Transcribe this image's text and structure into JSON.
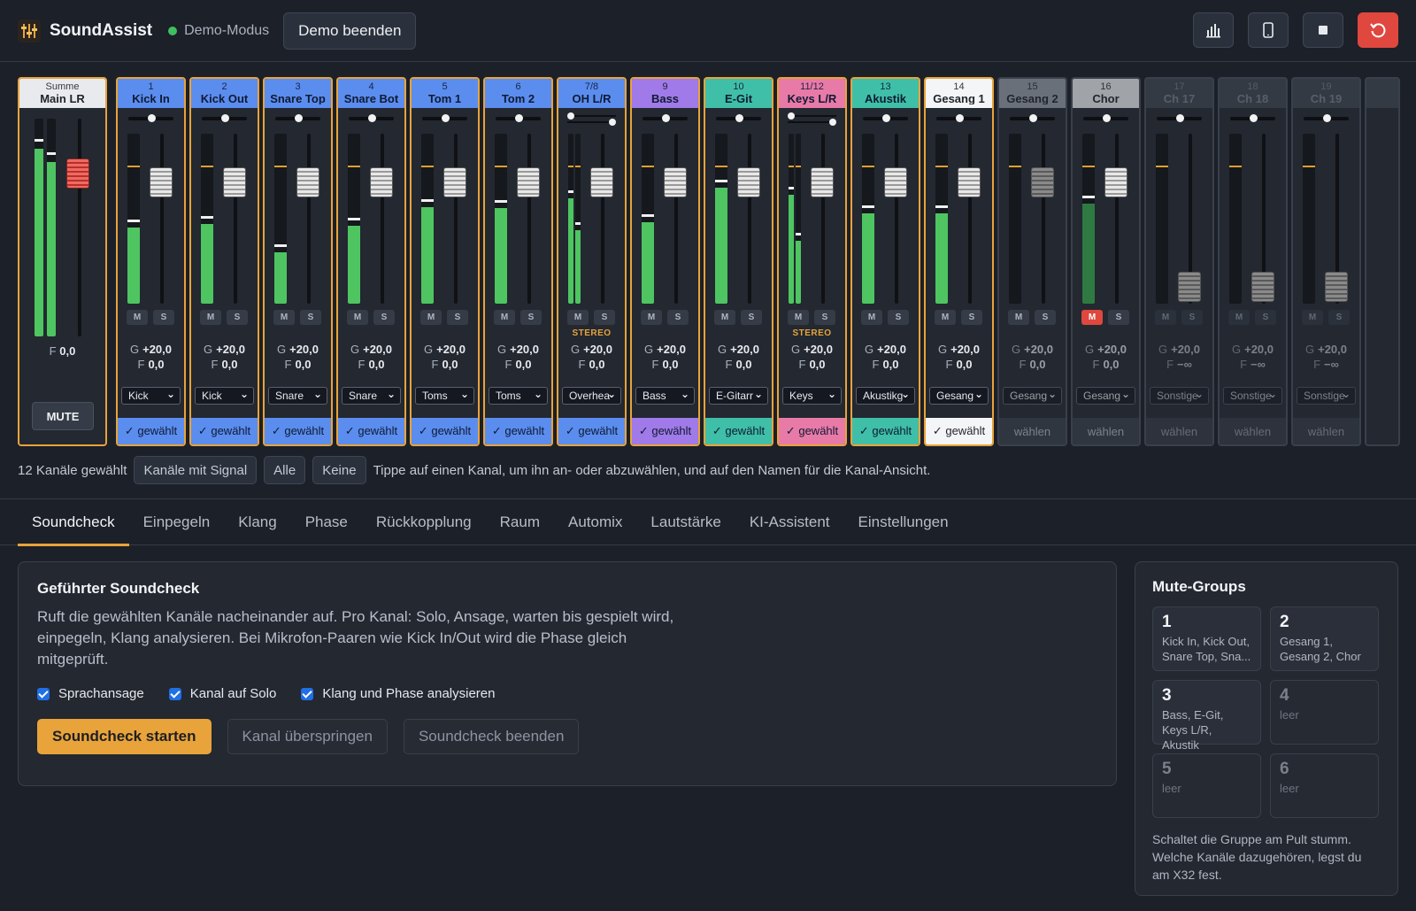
{
  "app": {
    "title": "SoundAssist",
    "mode_label": "Demo-Modus",
    "exit_demo": "Demo beenden"
  },
  "colors": {
    "accent": "#e8a33a",
    "meter": "#4ec561",
    "danger": "#e0473e",
    "blue": "#5b8def",
    "purple": "#a07ae8",
    "teal": "#3fbfa8",
    "pink": "#e87aa8"
  },
  "toolbar_icons": [
    "bar-chart-icon",
    "tablet-icon",
    "stop-icon",
    "reset-icon"
  ],
  "summe": {
    "label": "Summe",
    "name": "Main LR",
    "fader_label": "F",
    "fader_value": "0,0",
    "mute": "MUTE",
    "meter_levels": [
      0.86,
      0.8
    ],
    "fader_level": 0.75
  },
  "channels": [
    {
      "num": "1",
      "name": "Kick In",
      "gain": "+20,0",
      "fader": "0,0",
      "select": "Kick",
      "state": "✓ gewählt",
      "color": "#5b8def",
      "level": 0.45,
      "selected": true
    },
    {
      "num": "2",
      "name": "Kick Out",
      "gain": "+20,0",
      "fader": "0,0",
      "select": "Kick",
      "state": "✓ gewählt",
      "color": "#5b8def",
      "level": 0.47,
      "selected": true
    },
    {
      "num": "3",
      "name": "Snare Top",
      "gain": "+20,0",
      "fader": "0,0",
      "select": "Snare",
      "state": "✓ gewählt",
      "color": "#5b8def",
      "level": 0.3,
      "selected": true
    },
    {
      "num": "4",
      "name": "Snare Bot",
      "gain": "+20,0",
      "fader": "0,0",
      "select": "Snare",
      "state": "✓ gewählt",
      "color": "#5b8def",
      "level": 0.46,
      "selected": true
    },
    {
      "num": "5",
      "name": "Tom 1",
      "gain": "+20,0",
      "fader": "0,0",
      "select": "Toms",
      "state": "✓ gewählt",
      "color": "#5b8def",
      "level": 0.57,
      "selected": true
    },
    {
      "num": "6",
      "name": "Tom 2",
      "gain": "+20,0",
      "fader": "0,0",
      "select": "Toms",
      "state": "✓ gewählt",
      "color": "#5b8def",
      "level": 0.56,
      "selected": true
    },
    {
      "num": "7/8",
      "name": "OH L/R",
      "gain": "+20,0",
      "fader": "0,0",
      "select": "Overhea",
      "state": "✓ gewählt",
      "color": "#5b8def",
      "level": 0.62,
      "level_r": 0.43,
      "stereo": "STEREO",
      "selected": true
    },
    {
      "num": "9",
      "name": "Bass",
      "gain": "+20,0",
      "fader": "0,0",
      "select": "Bass",
      "state": "✓ gewählt",
      "color": "#a07ae8",
      "level": 0.48,
      "selected": true
    },
    {
      "num": "10",
      "name": "E-Git",
      "gain": "+20,0",
      "fader": "0,0",
      "select": "E-Gitarr",
      "state": "✓ gewählt",
      "color": "#3fbfa8",
      "level": 0.68,
      "selected": true
    },
    {
      "num": "11/12",
      "name": "Keys L/R",
      "gain": "+20,0",
      "fader": "0,0",
      "select": "Keys",
      "state": "✓ gewählt",
      "color": "#e87aa8",
      "level": 0.64,
      "level_r": 0.37,
      "stereo": "STEREO",
      "selected": true
    },
    {
      "num": "13",
      "name": "Akustik",
      "gain": "+20,0",
      "fader": "0,0",
      "select": "Akustikg",
      "state": "✓ gewählt",
      "color": "#3fbfa8",
      "level": 0.53,
      "selected": true
    },
    {
      "num": "14",
      "name": "Gesang 1",
      "gain": "+20,0",
      "fader": "0,0",
      "select": "Gesang",
      "state": "✓ gewählt",
      "color": "#f4f5f7",
      "level": 0.53,
      "selected": true
    },
    {
      "num": "15",
      "name": "Gesang 2",
      "gain": "+20,0",
      "fader": "0,0",
      "select": "Gesang",
      "state": "wählen",
      "color": "#9aa0aa",
      "level": 0,
      "selected": false
    },
    {
      "num": "16",
      "name": "Chor",
      "gain": "+20,0",
      "fader": "0,0",
      "select": "Gesang",
      "state": "wählen",
      "color": "#f4f5f7",
      "level": 0.59,
      "muted": true,
      "selected": false
    },
    {
      "num": "17",
      "name": "Ch 17",
      "gain": "+20,0",
      "fader": "−∞",
      "select": "Sonstige",
      "state": "wählen",
      "color": "#4a505c",
      "level": 0,
      "selected": false,
      "unused": true
    },
    {
      "num": "18",
      "name": "Ch 18",
      "gain": "+20,0",
      "fader": "−∞",
      "select": "Sonstige",
      "state": "wählen",
      "color": "#4a505c",
      "level": 0,
      "selected": false,
      "unused": true
    },
    {
      "num": "19",
      "name": "Ch 19",
      "gain": "+20,0",
      "fader": "−∞",
      "select": "Sonstige",
      "state": "wählen",
      "color": "#4a505c",
      "level": 0,
      "selected": false,
      "unused": true
    }
  ],
  "strip_labels": {
    "mute": "M",
    "solo": "S",
    "gain": "G",
    "fader": "F"
  },
  "selection": {
    "count": "12 Kanäle gewählt",
    "with_signal": "Kanäle mit Signal",
    "all": "Alle",
    "none": "Keine",
    "hint": "Tippe auf einen Kanal, um ihn an- oder abzuwählen, und auf den Namen für die Kanal-Ansicht."
  },
  "tabs": [
    "Soundcheck",
    "Einpegeln",
    "Klang",
    "Phase",
    "Rückkopplung",
    "Raum",
    "Automix",
    "Lautstärke",
    "KI-Assistent",
    "Einstellungen"
  ],
  "soundcheck": {
    "title": "Geführter Soundcheck",
    "description": "Ruft die gewählten Kanäle nacheinander auf. Pro Kanal: Solo, Ansage, warten bis gespielt wird, einpegeln, Klang analysieren. Bei Mikrofon-Paaren wie Kick In/Out wird die Phase gleich mitgeprüft.",
    "options": [
      "Sprachansage",
      "Kanal auf Solo",
      "Klang und Phase analysieren"
    ],
    "start": "Soundcheck starten",
    "skip": "Kanal überspringen",
    "stop": "Soundcheck beenden"
  },
  "mute_groups": {
    "title": "Mute-Groups",
    "groups": [
      {
        "num": "1",
        "text": "Kick In, Kick Out, Snare Top, Sna..."
      },
      {
        "num": "2",
        "text": "Gesang 1, Gesang 2, Chor"
      },
      {
        "num": "3",
        "text": "Bass, E-Git, Keys L/R, Akustik"
      },
      {
        "num": "4",
        "text": "leer"
      },
      {
        "num": "5",
        "text": "leer"
      },
      {
        "num": "6",
        "text": "leer"
      }
    ],
    "note": "Schaltet die Gruppe am Pult stumm. Welche Kanäle dazugehören, legst du am X32 fest."
  }
}
